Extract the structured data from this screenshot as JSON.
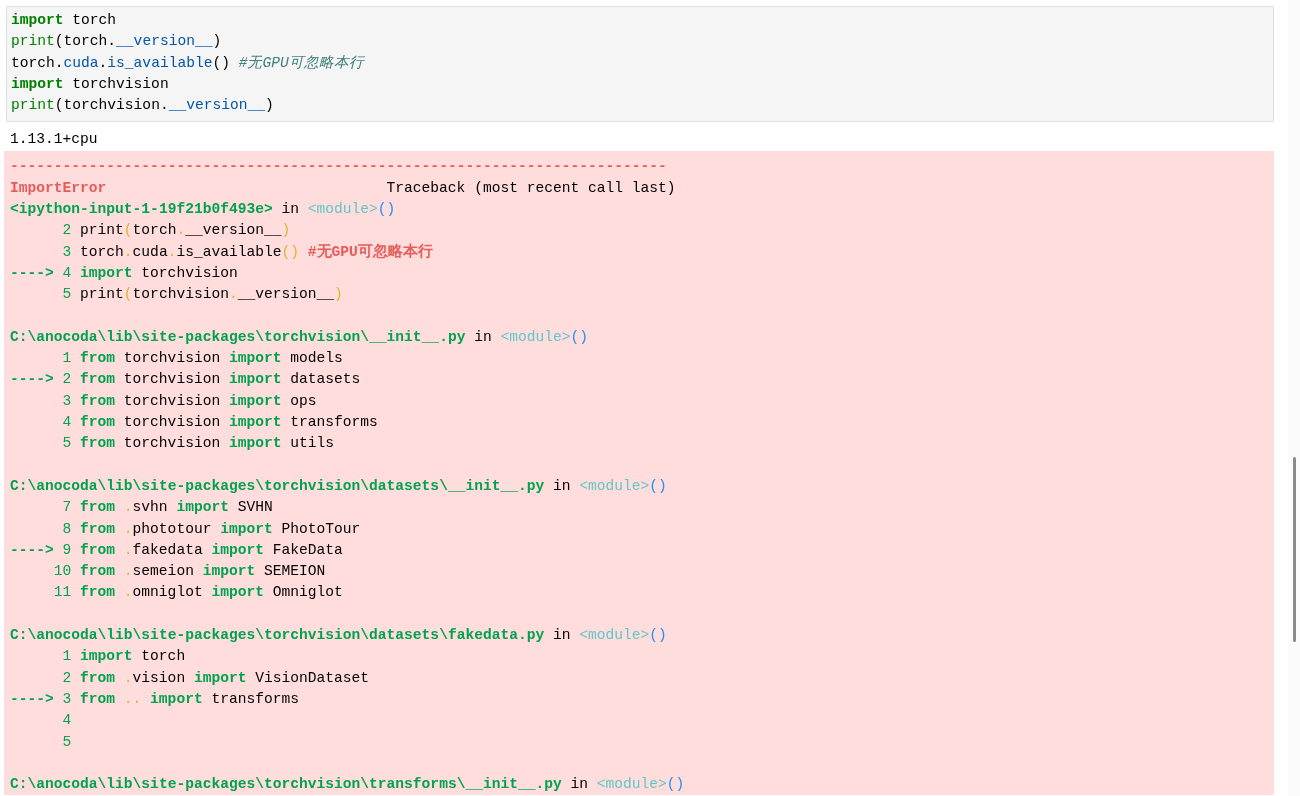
{
  "input_cell": {
    "lines": [
      [
        {
          "kind": "kw",
          "text": "import"
        },
        {
          "kind": "plain",
          "text": " torch"
        }
      ],
      [
        {
          "kind": "builtin",
          "text": "print"
        },
        {
          "kind": "plain",
          "text": "(torch."
        },
        {
          "kind": "attr",
          "text": "__version__"
        },
        {
          "kind": "plain",
          "text": ")"
        }
      ],
      [
        {
          "kind": "plain",
          "text": "torch."
        },
        {
          "kind": "attr",
          "text": "cuda"
        },
        {
          "kind": "plain",
          "text": "."
        },
        {
          "kind": "attr",
          "text": "is_available"
        },
        {
          "kind": "plain",
          "text": "() "
        },
        {
          "kind": "comment",
          "text": "#无GPU可忽略本行"
        }
      ],
      [
        {
          "kind": "kw",
          "text": "import"
        },
        {
          "kind": "plain",
          "text": " torchvision"
        }
      ],
      [
        {
          "kind": "builtin",
          "text": "print"
        },
        {
          "kind": "plain",
          "text": "(torchvision."
        },
        {
          "kind": "attr",
          "text": "__version__"
        },
        {
          "kind": "plain",
          "text": ")"
        }
      ]
    ]
  },
  "stdout": "1.13.1+cpu",
  "traceback": {
    "rule": "---------------------------------------------------------------------------",
    "error_name": "ImportError",
    "header_right": "Traceback (most recent call last)",
    "frames": [
      {
        "location": [
          {
            "kind": "tb-path",
            "text": "<ipython-input-1-19f21b0f493e>"
          },
          {
            "kind": "plain",
            "text": " in "
          },
          {
            "kind": "tb-cyan",
            "text": "<module>"
          },
          {
            "kind": "tb-blue",
            "text": "()"
          }
        ],
        "lines": [
          {
            "number": "2",
            "tokens": [
              {
                "kind": "plain",
                "text": "print"
              },
              {
                "kind": "tb-yellow",
                "text": "("
              },
              {
                "kind": "plain",
                "text": "torch"
              },
              {
                "kind": "tb-yellow",
                "text": "."
              },
              {
                "kind": "plain",
                "text": "__version__"
              },
              {
                "kind": "tb-yellow",
                "text": ")"
              }
            ]
          },
          {
            "number": "3",
            "tokens": [
              {
                "kind": "plain",
                "text": "torch"
              },
              {
                "kind": "tb-yellow",
                "text": "."
              },
              {
                "kind": "plain",
                "text": "cuda"
              },
              {
                "kind": "tb-yellow",
                "text": "."
              },
              {
                "kind": "plain",
                "text": "is_available"
              },
              {
                "kind": "tb-yellow",
                "text": "()"
              },
              {
                "kind": "tb-red",
                "text": " #无GPU可忽略本行"
              }
            ]
          },
          {
            "marker": "---->",
            "number": "4",
            "tokens": [
              {
                "kind": "tb-kw",
                "text": "import"
              },
              {
                "kind": "plain",
                "text": " torchvision"
              }
            ]
          },
          {
            "number": "5",
            "tokens": [
              {
                "kind": "plain",
                "text": "print"
              },
              {
                "kind": "tb-yellow",
                "text": "("
              },
              {
                "kind": "plain",
                "text": "torchvision"
              },
              {
                "kind": "tb-yellow",
                "text": "."
              },
              {
                "kind": "plain",
                "text": "__version__"
              },
              {
                "kind": "tb-yellow",
                "text": ")"
              }
            ]
          }
        ]
      },
      {
        "location": [
          {
            "kind": "tb-path",
            "text": "C:\\anocoda\\lib\\site-packages\\torchvision\\__init__.py"
          },
          {
            "kind": "plain",
            "text": " in "
          },
          {
            "kind": "tb-cyan",
            "text": "<module>"
          },
          {
            "kind": "tb-blue",
            "text": "()"
          }
        ],
        "lines": [
          {
            "number": "1",
            "tokens": [
              {
                "kind": "tb-kw",
                "text": "from"
              },
              {
                "kind": "plain",
                "text": " torchvision "
              },
              {
                "kind": "tb-kw",
                "text": "import"
              },
              {
                "kind": "plain",
                "text": " models"
              }
            ]
          },
          {
            "marker": "---->",
            "number": "2",
            "tokens": [
              {
                "kind": "tb-kw",
                "text": "from"
              },
              {
                "kind": "plain",
                "text": " torchvision "
              },
              {
                "kind": "tb-kw",
                "text": "import"
              },
              {
                "kind": "plain",
                "text": " datasets"
              }
            ]
          },
          {
            "number": "3",
            "tokens": [
              {
                "kind": "tb-kw",
                "text": "from"
              },
              {
                "kind": "plain",
                "text": " torchvision "
              },
              {
                "kind": "tb-kw",
                "text": "import"
              },
              {
                "kind": "plain",
                "text": " ops"
              }
            ]
          },
          {
            "number": "4",
            "tokens": [
              {
                "kind": "tb-kw",
                "text": "from"
              },
              {
                "kind": "plain",
                "text": " torchvision "
              },
              {
                "kind": "tb-kw",
                "text": "import"
              },
              {
                "kind": "plain",
                "text": " transforms"
              }
            ]
          },
          {
            "number": "5",
            "tokens": [
              {
                "kind": "tb-kw",
                "text": "from"
              },
              {
                "kind": "plain",
                "text": " torchvision "
              },
              {
                "kind": "tb-kw",
                "text": "import"
              },
              {
                "kind": "plain",
                "text": " utils"
              }
            ]
          }
        ]
      },
      {
        "location": [
          {
            "kind": "tb-path",
            "text": "C:\\anocoda\\lib\\site-packages\\torchvision\\datasets\\__init__.py"
          },
          {
            "kind": "plain",
            "text": " in "
          },
          {
            "kind": "tb-cyan",
            "text": "<module>"
          },
          {
            "kind": "tb-blue",
            "text": "()"
          }
        ],
        "lines": [
          {
            "number": "7",
            "tokens": [
              {
                "kind": "tb-kw",
                "text": "from"
              },
              {
                "kind": "tb-yellow",
                "text": " ."
              },
              {
                "kind": "plain",
                "text": "svhn "
              },
              {
                "kind": "tb-kw",
                "text": "import"
              },
              {
                "kind": "plain",
                "text": " SVHN"
              }
            ]
          },
          {
            "number": "8",
            "tokens": [
              {
                "kind": "tb-kw",
                "text": "from"
              },
              {
                "kind": "tb-yellow",
                "text": " ."
              },
              {
                "kind": "plain",
                "text": "phototour "
              },
              {
                "kind": "tb-kw",
                "text": "import"
              },
              {
                "kind": "plain",
                "text": " PhotoTour"
              }
            ]
          },
          {
            "marker": "---->",
            "number": "9",
            "tokens": [
              {
                "kind": "tb-kw",
                "text": "from"
              },
              {
                "kind": "tb-yellow",
                "text": " ."
              },
              {
                "kind": "plain",
                "text": "fakedata "
              },
              {
                "kind": "tb-kw",
                "text": "import"
              },
              {
                "kind": "plain",
                "text": " FakeData"
              }
            ]
          },
          {
            "number": "10",
            "tokens": [
              {
                "kind": "tb-kw",
                "text": "from"
              },
              {
                "kind": "tb-yellow",
                "text": " ."
              },
              {
                "kind": "plain",
                "text": "semeion "
              },
              {
                "kind": "tb-kw",
                "text": "import"
              },
              {
                "kind": "plain",
                "text": " SEMEION"
              }
            ]
          },
          {
            "number": "11",
            "tokens": [
              {
                "kind": "tb-kw",
                "text": "from"
              },
              {
                "kind": "tb-yellow",
                "text": " ."
              },
              {
                "kind": "plain",
                "text": "omniglot "
              },
              {
                "kind": "tb-kw",
                "text": "import"
              },
              {
                "kind": "plain",
                "text": " Omniglot"
              }
            ]
          }
        ]
      },
      {
        "location": [
          {
            "kind": "tb-path",
            "text": "C:\\anocoda\\lib\\site-packages\\torchvision\\datasets\\fakedata.py"
          },
          {
            "kind": "plain",
            "text": " in "
          },
          {
            "kind": "tb-cyan",
            "text": "<module>"
          },
          {
            "kind": "tb-blue",
            "text": "()"
          }
        ],
        "lines": [
          {
            "number": "1",
            "tokens": [
              {
                "kind": "tb-kw",
                "text": "import"
              },
              {
                "kind": "plain",
                "text": " torch"
              }
            ]
          },
          {
            "number": "2",
            "tokens": [
              {
                "kind": "tb-kw",
                "text": "from"
              },
              {
                "kind": "tb-yellow",
                "text": " ."
              },
              {
                "kind": "plain",
                "text": "vision "
              },
              {
                "kind": "tb-kw",
                "text": "import"
              },
              {
                "kind": "plain",
                "text": " VisionDataset"
              }
            ]
          },
          {
            "marker": "---->",
            "number": "3",
            "tokens": [
              {
                "kind": "tb-kw",
                "text": "from"
              },
              {
                "kind": "tb-yellow",
                "text": " .. "
              },
              {
                "kind": "tb-kw",
                "text": "import"
              },
              {
                "kind": "plain",
                "text": " transforms"
              }
            ]
          },
          {
            "number": "4"
          },
          {
            "number": "5"
          }
        ]
      },
      {
        "location": [
          {
            "kind": "tb-path",
            "text": "C:\\anocoda\\lib\\site-packages\\torchvision\\transforms\\__init__.py"
          },
          {
            "kind": "plain",
            "text": " in "
          },
          {
            "kind": "tb-cyan",
            "text": "<module>"
          },
          {
            "kind": "tb-blue",
            "text": "()"
          }
        ]
      }
    ]
  }
}
